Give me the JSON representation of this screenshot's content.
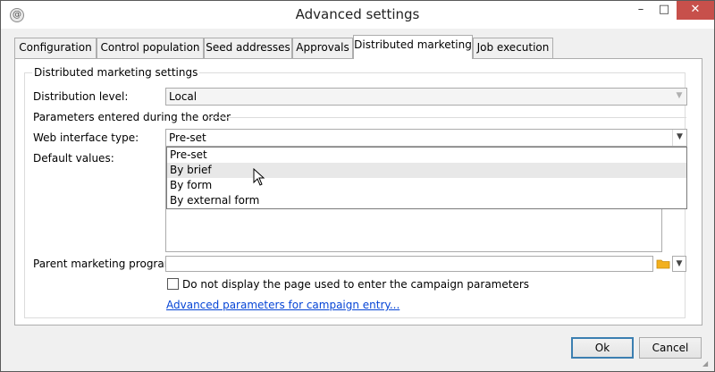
{
  "window": {
    "title": "Advanced settings",
    "app_icon": "app-logo-icon",
    "controls": {
      "minimize": "–",
      "maximize": "□",
      "close": "✕"
    }
  },
  "tabs": [
    {
      "label": "Configuration",
      "active": false
    },
    {
      "label": "Control population",
      "active": false
    },
    {
      "label": "Seed addresses",
      "active": false
    },
    {
      "label": "Approvals",
      "active": false
    },
    {
      "label": "Distributed marketing",
      "active": true
    },
    {
      "label": "Job execution",
      "active": false
    }
  ],
  "panel": {
    "group_title": "Distributed marketing settings",
    "distribution_level": {
      "label": "Distribution level:",
      "value": "Local",
      "disabled": true
    },
    "section_title": "Parameters entered during the order",
    "web_interface": {
      "label": "Web interface type:",
      "value": "Pre-set",
      "options": [
        "Pre-set",
        "By brief",
        "By form",
        "By external form"
      ],
      "hovered_option": "By brief"
    },
    "default_values": {
      "label": "Default values:"
    },
    "parent_program": {
      "label": "Parent marketing program:",
      "value": ""
    },
    "hide_page_checkbox": {
      "label": "Do not display the page used to enter the campaign parameters",
      "checked": false
    },
    "advanced_link": "Advanced parameters for campaign entry..."
  },
  "buttons": {
    "ok": "Ok",
    "cancel": "Cancel"
  },
  "colors": {
    "close_button": "#c7504b",
    "link": "#0645d6",
    "default_button_border": "#3c7fb1",
    "folder_icon": "#f2b01e"
  }
}
